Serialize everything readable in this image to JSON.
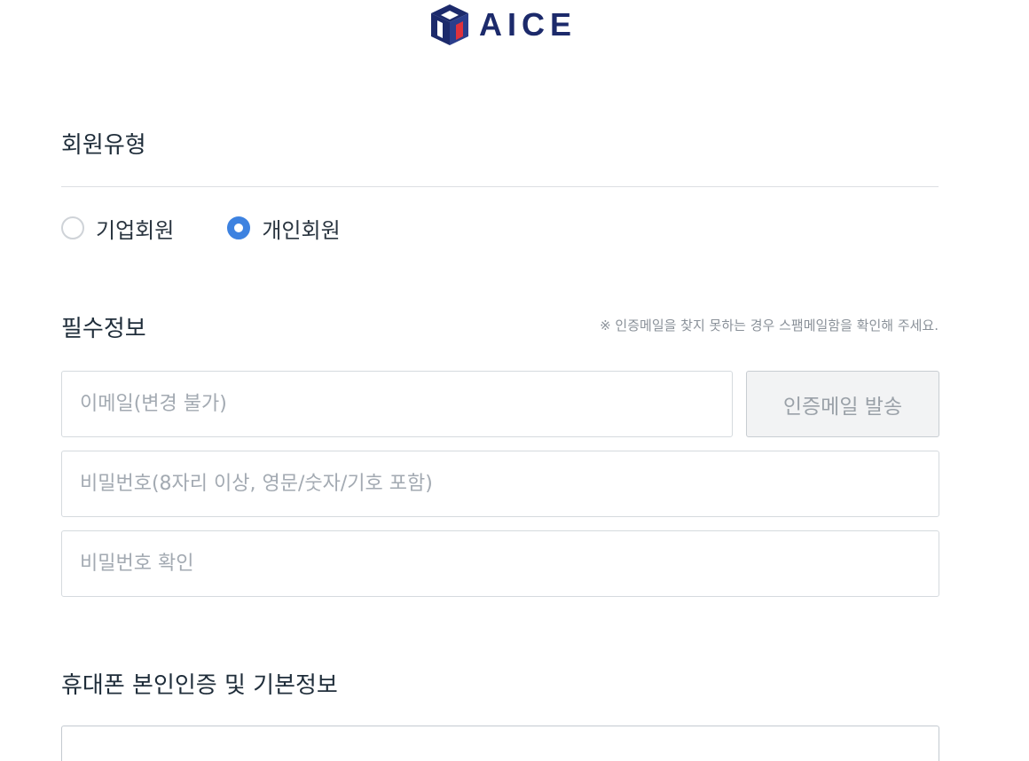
{
  "header": {
    "logo_text": "AICE"
  },
  "member_type": {
    "title": "회원유형",
    "options": [
      {
        "label": "기업회원",
        "checked": false
      },
      {
        "label": "개인회원",
        "checked": true
      }
    ]
  },
  "required_info": {
    "title": "필수정보",
    "notice": "※ 인증메일을 찾지 못하는 경우 스팸메일함을 확인해 주세요.",
    "email_placeholder": "이메일(변경 불가)",
    "send_button_label": "인증메일 발송",
    "password_placeholder": "비밀번호(8자리 이상, 영문/숫자/기호 포함)",
    "password_confirm_placeholder": "비밀번호 확인"
  },
  "phone_verification": {
    "title": "휴대폰 본인인증 및 기본정보"
  },
  "colors": {
    "accent": "#3d82e0",
    "brand": "#1c2a6b",
    "brand_red": "#e0323c"
  }
}
